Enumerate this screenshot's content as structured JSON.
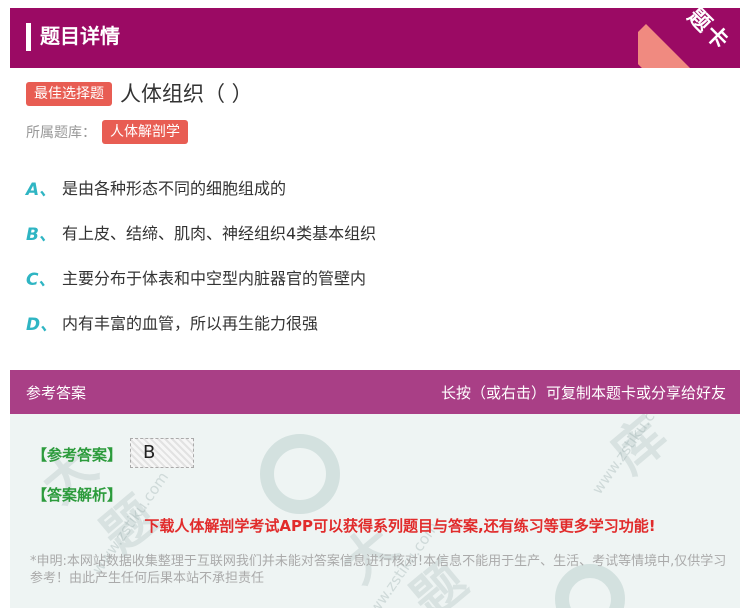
{
  "header": {
    "title": "题目详情",
    "corner_label": "题卡"
  },
  "question": {
    "type_tag": "最佳选择题",
    "title": "人体组织（ ）",
    "bank_label": "所属题库：",
    "bank_name": "人体解剖学",
    "options": [
      {
        "letter": "A、",
        "text": "是由各种形态不同的细胞组成的"
      },
      {
        "letter": "B、",
        "text": "有上皮、结缔、肌肉、神经组织4类基本组织"
      },
      {
        "letter": "C、",
        "text": "主要分布于体表和中空型内脏器官的管壁内"
      },
      {
        "letter": "D、",
        "text": "内有丰富的血管，所以再生能力很强"
      }
    ]
  },
  "answer": {
    "header_left": "参考答案",
    "header_right": "长按（或右击）可复制本题卡或分享给好友",
    "answer_label": "【参考答案】",
    "answer_value": "B",
    "analysis_label": "【答案解析】",
    "promo": "下载人体解剖学考试APP可以获得系列题目与答案,还有练习等更多学习功能!",
    "disclaimer": "*申明:本网站数据收集整理于互联网我们并未能对答案信息进行核对!本信息不能用于生产、生活、考试等情境中,仅供学习参考！由此产生任何后果本站不承担责任"
  },
  "colors": {
    "header_bg": "#9b0a64",
    "answer_header_bg": "#a93f86",
    "tag_bg": "#e85d53",
    "option_letter": "#2fb5c3",
    "answer_label": "#2c9b3c",
    "promo_text": "#e12b2b"
  }
}
